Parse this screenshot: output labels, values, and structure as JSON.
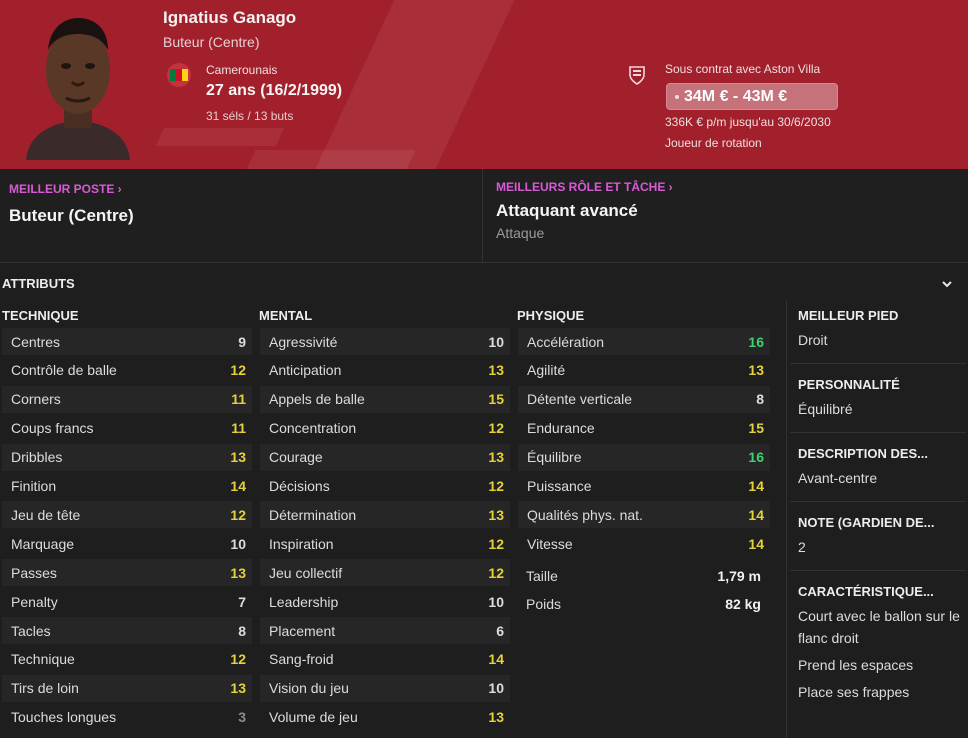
{
  "header": {
    "name": "Ignatius Ganago",
    "position": "Buteur (Centre)",
    "nationality": "Camerounais",
    "age": "27 ans (16/2/1999)",
    "caps": "31 séls / 13 buts",
    "contract": "Sous contrat avec Aston Villa",
    "value": "34M € - 43M €",
    "wage": "336K € p/m jusqu'au 30/6/2030",
    "squad_status": "Joueur de rotation",
    "flag_colors": [
      "#007a3d",
      "#ce1126",
      "#fcd116"
    ],
    "header_color": "#a2202c"
  },
  "best": {
    "position_label": "MEILLEUR POSTE",
    "position_value": "Buteur (Centre)",
    "role_label": "MEILLEURS RÔLE ET TÂCHE",
    "role_value": "Attaquant avancé",
    "role_duty": "Attaque"
  },
  "attributes": {
    "title": "ATTRIBUTS",
    "technique": {
      "title": "TECHNIQUE",
      "items": [
        {
          "name": "Centres",
          "value": "9"
        },
        {
          "name": "Contrôle de balle",
          "value": "12"
        },
        {
          "name": "Corners",
          "value": "11"
        },
        {
          "name": "Coups francs",
          "value": "11"
        },
        {
          "name": "Dribbles",
          "value": "13"
        },
        {
          "name": "Finition",
          "value": "14"
        },
        {
          "name": "Jeu de tête",
          "value": "12"
        },
        {
          "name": "Marquage",
          "value": "10"
        },
        {
          "name": "Passes",
          "value": "13"
        },
        {
          "name": "Penalty",
          "value": "7"
        },
        {
          "name": "Tacles",
          "value": "8"
        },
        {
          "name": "Technique",
          "value": "12"
        },
        {
          "name": "Tirs de loin",
          "value": "13"
        },
        {
          "name": "Touches longues",
          "value": "3"
        }
      ]
    },
    "mental": {
      "title": "MENTAL",
      "items": [
        {
          "name": "Agressivité",
          "value": "10"
        },
        {
          "name": "Anticipation",
          "value": "13"
        },
        {
          "name": "Appels de balle",
          "value": "15"
        },
        {
          "name": "Concentration",
          "value": "12"
        },
        {
          "name": "Courage",
          "value": "13"
        },
        {
          "name": "Décisions",
          "value": "12"
        },
        {
          "name": "Détermination",
          "value": "13"
        },
        {
          "name": "Inspiration",
          "value": "12"
        },
        {
          "name": "Jeu collectif",
          "value": "12"
        },
        {
          "name": "Leadership",
          "value": "10"
        },
        {
          "name": "Placement",
          "value": "6"
        },
        {
          "name": "Sang-froid",
          "value": "14"
        },
        {
          "name": "Vision du jeu",
          "value": "10"
        },
        {
          "name": "Volume de jeu",
          "value": "13"
        }
      ]
    },
    "physique": {
      "title": "PHYSIQUE",
      "items": [
        {
          "name": "Accélération",
          "value": "16"
        },
        {
          "name": "Agilité",
          "value": "13"
        },
        {
          "name": "Détente verticale",
          "value": "8"
        },
        {
          "name": "Endurance",
          "value": "15"
        },
        {
          "name": "Équilibre",
          "value": "16"
        },
        {
          "name": "Puissance",
          "value": "14"
        },
        {
          "name": "Qualités phys. nat.",
          "value": "14"
        },
        {
          "name": "Vitesse",
          "value": "14"
        }
      ],
      "height_label": "Taille",
      "height_value": "1,79 m",
      "weight_label": "Poids",
      "weight_value": "82 kg"
    }
  },
  "sidebar": {
    "foot_title": "MEILLEUR PIED",
    "foot_value": "Droit",
    "personality_title": "PERSONNALITÉ",
    "personality_value": "Équilibré",
    "description_title": "DESCRIPTION DES...",
    "description_value": "Avant-centre",
    "gk_title": "NOTE (GARDIEN DE...",
    "gk_value": "2",
    "traits_title": "CARACTÉRISTIQUE...",
    "traits": [
      "Court avec le ballon sur le flanc droit",
      "Prend les espaces",
      "Place ses frappes"
    ]
  },
  "colors": {
    "value_low": "#dcdcdc",
    "value_mid": "#e4d23a",
    "value_high": "#3fd16f",
    "value_poor": "#8c8c8c",
    "accent": "#d85bd6"
  }
}
